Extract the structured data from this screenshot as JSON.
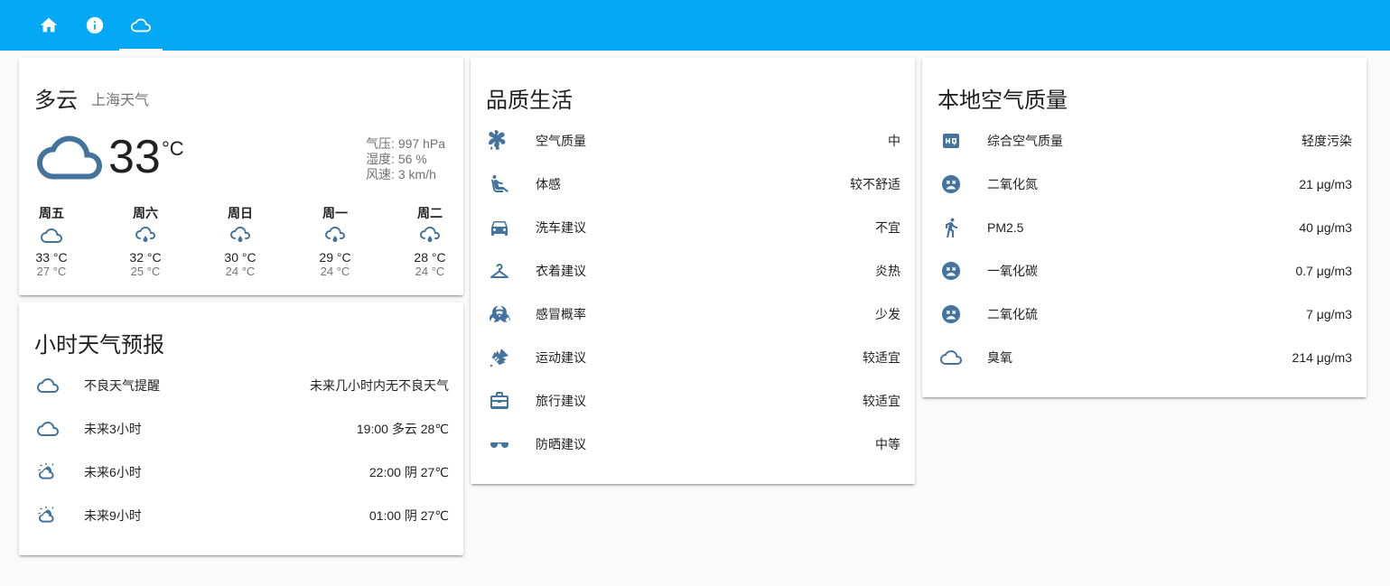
{
  "toolbar": {
    "tabs": [
      {
        "icon": "home-icon"
      },
      {
        "icon": "info-icon"
      },
      {
        "icon": "cloud-icon",
        "active": true
      }
    ],
    "color": "#03a9f4"
  },
  "weather": {
    "condition": "多云",
    "location": "上海天气",
    "temperature": "33",
    "unit": "°C",
    "attributes": [
      "气压: 997 hPa",
      "湿度: 56 %",
      "风速: 3 km/h"
    ],
    "forecast": [
      {
        "day": "周五",
        "icon": "cloud-icon",
        "high": "33 °C",
        "low": "27 °C"
      },
      {
        "day": "周六",
        "icon": "cloud-rain-icon",
        "high": "32 °C",
        "low": "25 °C"
      },
      {
        "day": "周日",
        "icon": "cloud-rain-icon",
        "high": "30 °C",
        "low": "24 °C"
      },
      {
        "day": "周一",
        "icon": "cloud-rain-icon",
        "high": "29 °C",
        "low": "24 °C"
      },
      {
        "day": "周二",
        "icon": "cloud-rain-icon",
        "high": "28 °C",
        "low": "24 °C"
      }
    ]
  },
  "hourly": {
    "title": "小时天气预报",
    "rows": [
      {
        "icon": "cloud-icon",
        "label": "不良天气提醒",
        "value": "未来几小时内无不良天气"
      },
      {
        "icon": "cloud-icon",
        "label": "未来3小时",
        "value": "19:00 多云 28℃"
      },
      {
        "icon": "partly-cloudy-icon",
        "label": "未来6小时",
        "value": "22:00 阴 27℃"
      },
      {
        "icon": "partly-cloudy-icon",
        "label": "未来9小时",
        "value": "01:00 阴 27℃"
      }
    ]
  },
  "life": {
    "title": "品质生活",
    "rows": [
      {
        "icon": "air-conditioner-icon",
        "label": "空气质量",
        "value": "中"
      },
      {
        "icon": "seat-recline-icon",
        "label": "体感",
        "value": "较不舒适"
      },
      {
        "icon": "car-icon",
        "label": "洗车建议",
        "value": "不宜"
      },
      {
        "icon": "hanger-icon",
        "label": "衣着建议",
        "value": "炎热"
      },
      {
        "icon": "biohazard-icon",
        "label": "感冒概率",
        "value": "少发"
      },
      {
        "icon": "badminton-icon",
        "label": "运动建议",
        "value": "较适宜"
      },
      {
        "icon": "briefcase-icon",
        "label": "旅行建议",
        "value": "较适宜"
      },
      {
        "icon": "sunglasses-icon",
        "label": "防晒建议",
        "value": "中等"
      }
    ]
  },
  "air": {
    "title": "本地空气质量",
    "rows": [
      {
        "icon": "hq-icon",
        "label": "综合空气质量",
        "value": "轻度污染"
      },
      {
        "icon": "emoticon-dead-icon",
        "label": "二氧化氮",
        "value": "21 μg/m3"
      },
      {
        "icon": "walk-icon",
        "label": "PM2.5",
        "value": "40 μg/m3"
      },
      {
        "icon": "emoticon-dead-icon",
        "label": "一氧化碳",
        "value": "0.7 μg/m3"
      },
      {
        "icon": "emoticon-dead-icon",
        "label": "二氧化硫",
        "value": "7 μg/m3"
      },
      {
        "icon": "cloud-icon",
        "label": "臭氧",
        "value": "214 μg/m3"
      }
    ]
  },
  "colors": {
    "icon": "#44739e",
    "secondary_text": "#757575"
  }
}
